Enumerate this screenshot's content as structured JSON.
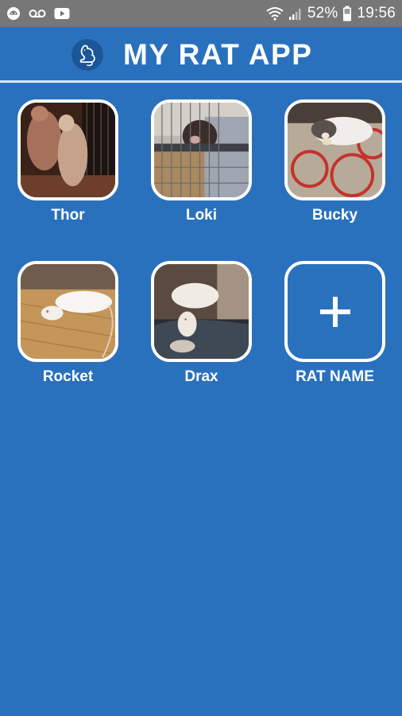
{
  "status_bar": {
    "battery_percent": "52%",
    "time": "19:56",
    "icons": [
      "android-icon",
      "voicemail-icon",
      "youtube-icon",
      "wifi-icon",
      "signal-icon",
      "battery-icon"
    ]
  },
  "header": {
    "title": "MY RAT APP",
    "logo_icon": "rat-logo-icon"
  },
  "rats": [
    {
      "name": "Thor"
    },
    {
      "name": "Loki"
    },
    {
      "name": "Bucky"
    },
    {
      "name": "Rocket"
    },
    {
      "name": "Drax"
    }
  ],
  "add_tile": {
    "label": "RAT NAME",
    "icon": "plus-icon"
  },
  "colors": {
    "background": "#2a71bd",
    "status_bar": "#777777",
    "accent": "#ffffff"
  }
}
